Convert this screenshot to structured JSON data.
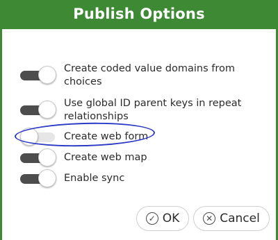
{
  "dialog": {
    "title": "Publish Options"
  },
  "options": [
    {
      "label": "Create coded value domains from choices",
      "enabled": true
    },
    {
      "label": "Use global ID parent keys in repeat relationships",
      "enabled": true
    },
    {
      "label": "Create web form",
      "enabled": false
    },
    {
      "label": "Create web map",
      "enabled": true
    },
    {
      "label": "Enable sync",
      "enabled": true
    }
  ],
  "buttons": {
    "ok_label": "OK",
    "cancel_label": "Cancel"
  },
  "colors": {
    "header_green": "#3e8a34",
    "toggle_on": "#4d4d4d",
    "toggle_off": "#e6e6e6",
    "annotation_ink": "#2b39c5"
  },
  "icons": {
    "ok": "check-circle-icon",
    "cancel": "x-circle-icon"
  }
}
